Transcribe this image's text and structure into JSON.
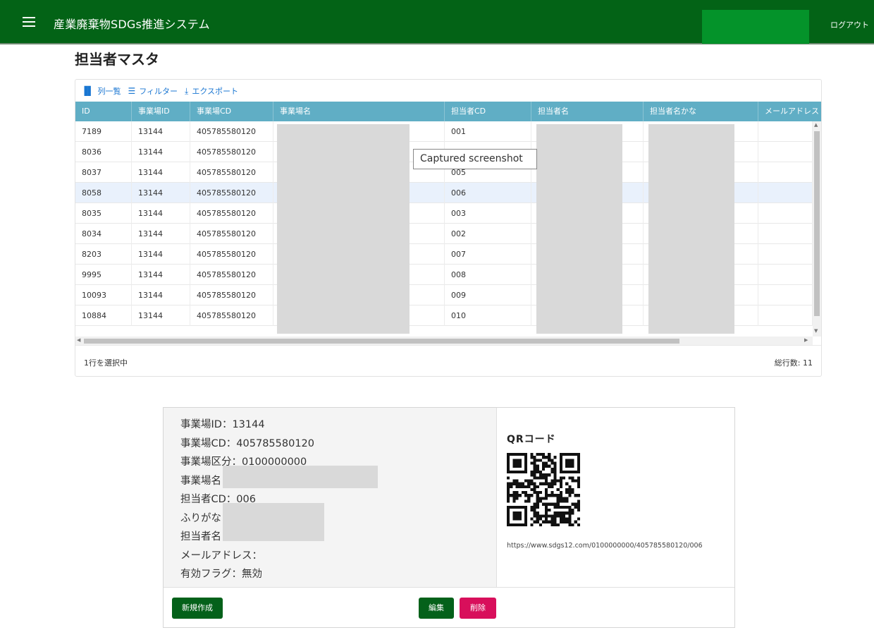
{
  "app": {
    "title": "産業廃棄物SDGs推進システム",
    "logout": "ログアウト"
  },
  "page": {
    "title": "担当者マスタ"
  },
  "toolbar": {
    "columns": "列一覧",
    "filter": "フィルター",
    "export": "エクスポート"
  },
  "grid": {
    "headers": [
      "ID",
      "事業場ID",
      "事業場CD",
      "事業場名",
      "担当者CD",
      "担当者名",
      "担当者名かな",
      "メールアドレス"
    ],
    "rows": [
      {
        "id": "7189",
        "site_id": "13144",
        "site_cd": "405785580120",
        "site_name": "",
        "cd": "001",
        "name": "",
        "kana": "",
        "mail": ""
      },
      {
        "id": "8036",
        "site_id": "13144",
        "site_cd": "405785580120",
        "site_name": "",
        "cd": "",
        "name": "",
        "kana": "",
        "mail": ""
      },
      {
        "id": "8037",
        "site_id": "13144",
        "site_cd": "405785580120",
        "site_name": "",
        "cd": "005",
        "name": "",
        "kana": "",
        "mail": ""
      },
      {
        "id": "8058",
        "site_id": "13144",
        "site_cd": "405785580120",
        "site_name": "",
        "cd": "006",
        "name": "",
        "kana": "",
        "mail": ""
      },
      {
        "id": "8035",
        "site_id": "13144",
        "site_cd": "405785580120",
        "site_name": "",
        "cd": "003",
        "name": "",
        "kana": "",
        "mail": ""
      },
      {
        "id": "8034",
        "site_id": "13144",
        "site_cd": "405785580120",
        "site_name": "",
        "cd": "002",
        "name": "",
        "kana": "",
        "mail": ""
      },
      {
        "id": "8203",
        "site_id": "13144",
        "site_cd": "405785580120",
        "site_name": "",
        "cd": "007",
        "name": "",
        "kana": "",
        "mail": ""
      },
      {
        "id": "9995",
        "site_id": "13144",
        "site_cd": "405785580120",
        "site_name": "",
        "cd": "008",
        "name": "",
        "kana": "",
        "mail": ""
      },
      {
        "id": "10093",
        "site_id": "13144",
        "site_cd": "405785580120",
        "site_name": "",
        "cd": "009",
        "name": "",
        "kana": "",
        "mail": ""
      },
      {
        "id": "10884",
        "site_id": "13144",
        "site_cd": "405785580120",
        "site_name": "",
        "cd": "010",
        "name": "",
        "kana": "",
        "mail": ""
      }
    ],
    "selected_row": 3,
    "footer_left": "1行を選択中",
    "footer_right": "総行数: 11"
  },
  "tooltip": "Captured screenshot",
  "detail": {
    "site_id": "事業場ID：13144",
    "site_cd": "事業場CD：405785580120",
    "site_kubun": "事業場区分：0100000000",
    "site_name": "事業場名：",
    "person_cd": "担当者CD：006",
    "furigana": "ふりがな：",
    "person_name": "担当者名：",
    "mail": "メールアドレス：",
    "valid_flag": "有効フラグ：無効",
    "qr_title": "QRコード",
    "qr_url": "https://www.sdgs12.com/0100000000/405785580120/006",
    "btn_new": "新規作成",
    "btn_edit": "編集",
    "btn_delete": "削除"
  },
  "colors": {
    "appbar": "#036316",
    "grid_header": "#60aec5",
    "button_primary": "#04611a",
    "button_danger": "#d80f5b",
    "selected_row": "#e9f1fc"
  },
  "icons": {
    "menu": "menu-icon",
    "columns": "columns-icon",
    "filter": "filter-icon",
    "export": "export-icon",
    "qr": "qr-code-icon"
  }
}
